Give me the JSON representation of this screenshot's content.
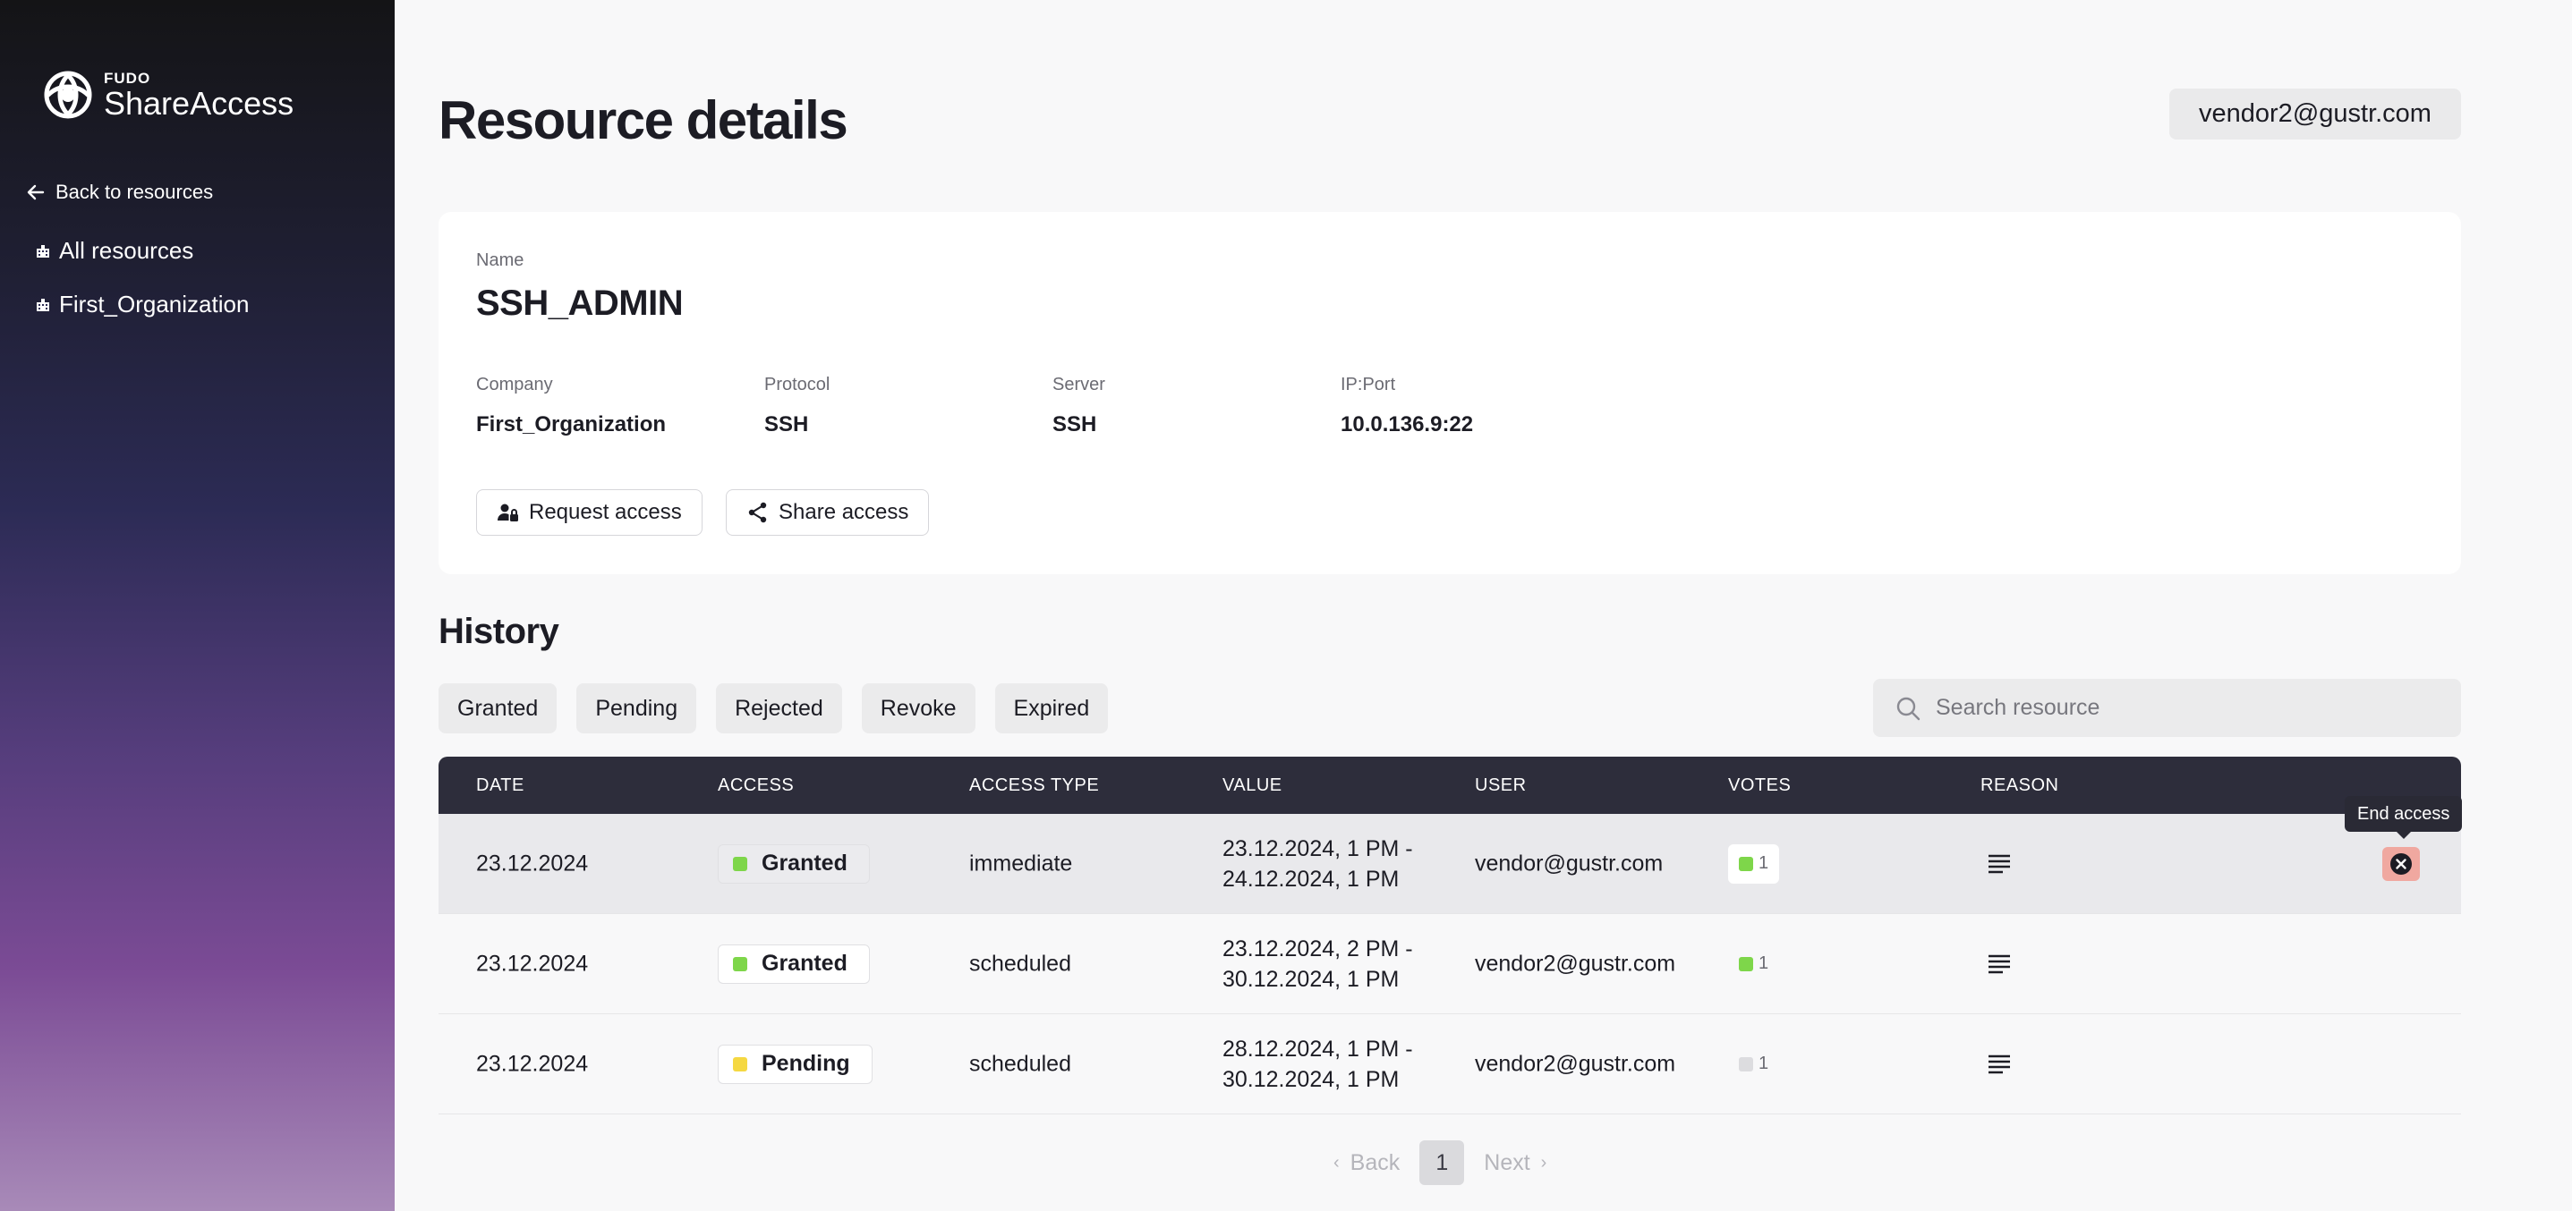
{
  "sidebar": {
    "brand": "FUDO",
    "product": "ShareAccess",
    "back_label": "Back to resources",
    "items": [
      {
        "label": "All resources",
        "icon": "building-icon"
      },
      {
        "label": "First_Organization",
        "icon": "building-icon"
      }
    ]
  },
  "header": {
    "title": "Resource details",
    "user_email": "vendor2@gustr.com"
  },
  "resource": {
    "name_label": "Name",
    "name": "SSH_ADMIN",
    "fields": [
      {
        "label": "Company",
        "value": "First_Organization"
      },
      {
        "label": "Protocol",
        "value": "SSH"
      },
      {
        "label": "Server",
        "value": "SSH"
      },
      {
        "label": "IP:Port",
        "value": "10.0.136.9:22"
      }
    ],
    "request_label": "Request access",
    "share_label": "Share access"
  },
  "history": {
    "title": "History",
    "filters": [
      "Granted",
      "Pending",
      "Rejected",
      "Revoke",
      "Expired"
    ],
    "search_placeholder": "Search resource",
    "columns": [
      "DATE",
      "ACCESS",
      "ACCESS TYPE",
      "VALUE",
      "USER",
      "VOTES",
      "REASON"
    ],
    "rows": [
      {
        "date": "23.12.2024",
        "access": "Granted",
        "access_color": "#7ed64a",
        "type": "immediate",
        "value_line1": "23.12.2024, 1 PM -",
        "value_line2": "24.12.2024, 1 PM",
        "user": "vendor@gustr.com",
        "votes": "1",
        "vote_color": "#7ed64a"
      },
      {
        "date": "23.12.2024",
        "access": "Granted",
        "access_color": "#7ed64a",
        "type": "scheduled",
        "value_line1": "23.12.2024, 2 PM -",
        "value_line2": "30.12.2024, 1 PM",
        "user": "vendor2@gustr.com",
        "votes": "1",
        "vote_color": "#7ed64a"
      },
      {
        "date": "23.12.2024",
        "access": "Pending",
        "access_color": "#f5d842",
        "type": "scheduled",
        "value_line1": "28.12.2024, 1 PM -",
        "value_line2": "30.12.2024, 1 PM",
        "user": "vendor2@gustr.com",
        "votes": "1",
        "vote_color": "#dcdcdf"
      }
    ],
    "end_access_tooltip": "End access"
  },
  "pagination": {
    "back_label": "Back",
    "next_label": "Next",
    "current_page": "1"
  }
}
